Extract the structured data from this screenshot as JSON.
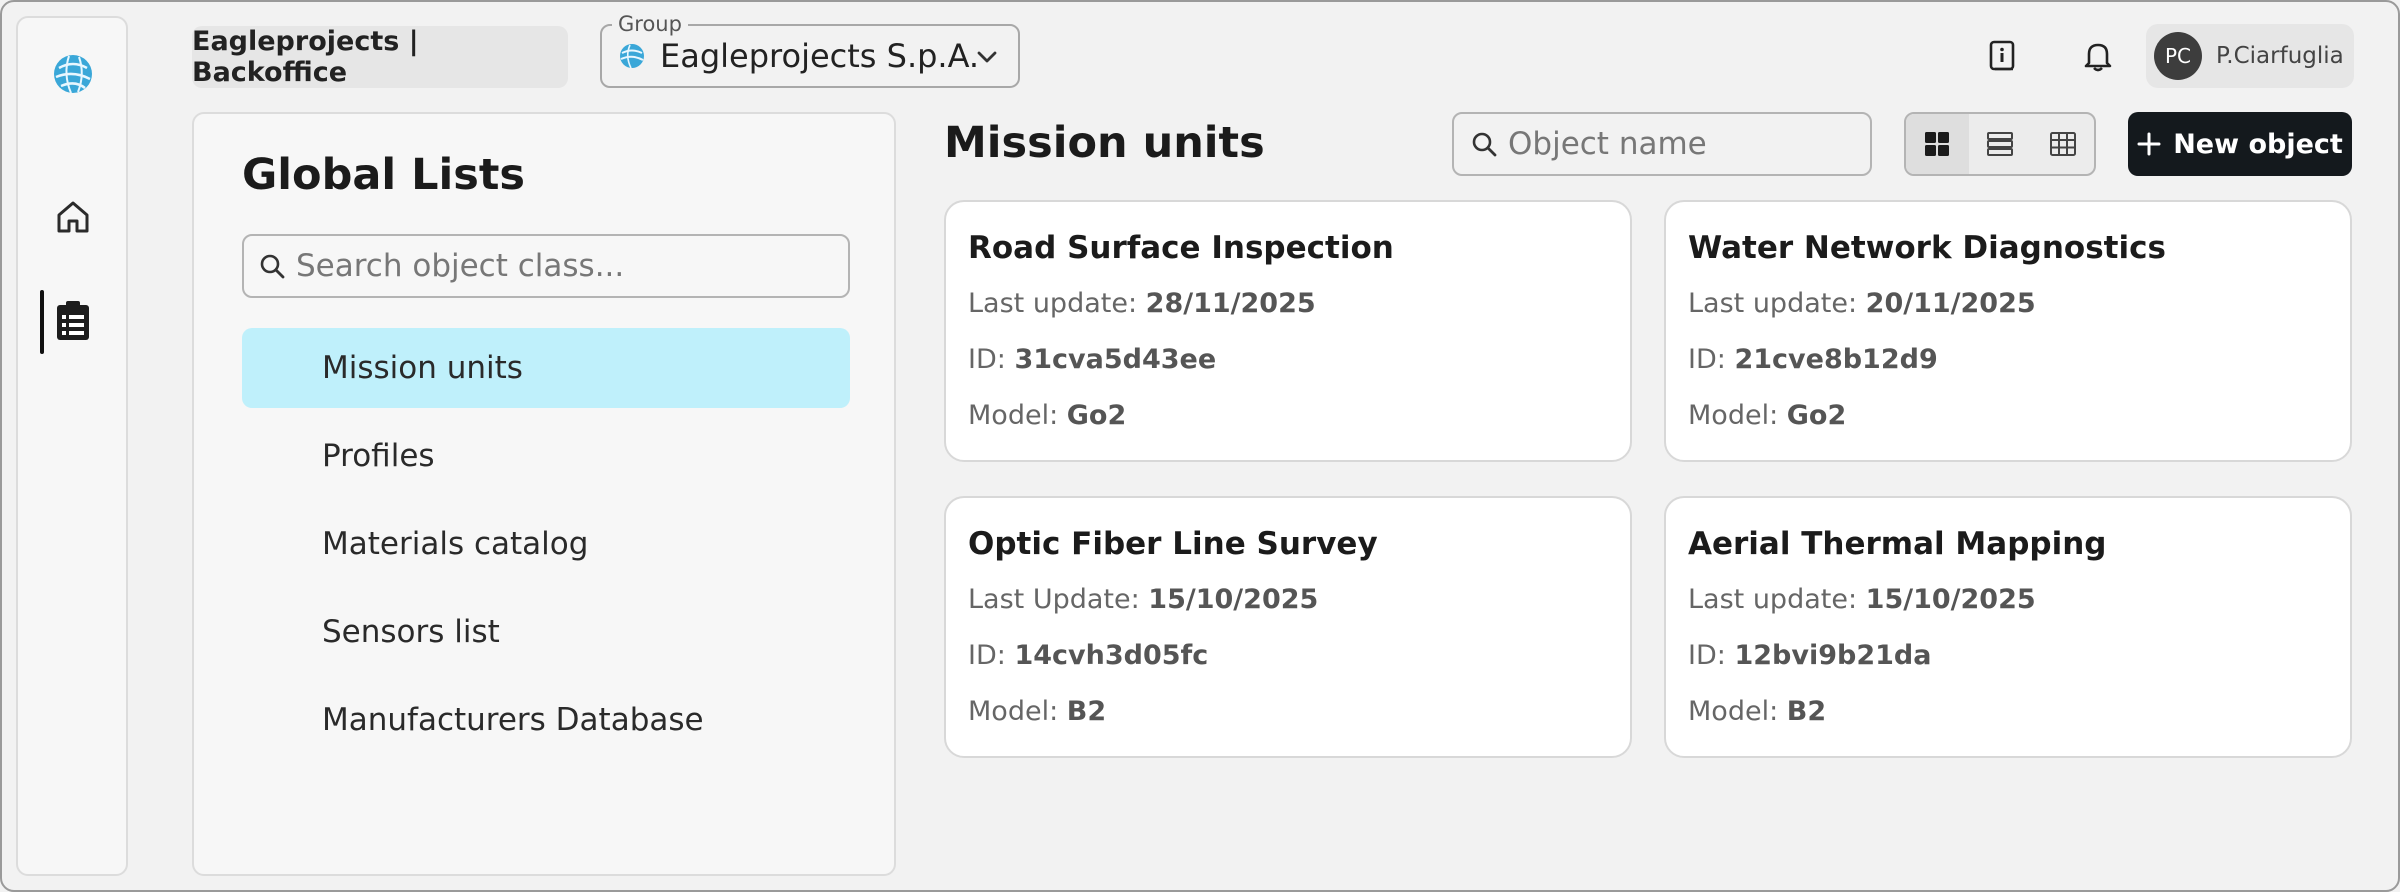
{
  "header": {
    "breadcrumb": "Eagleprojects | Backoffice",
    "group_legend": "Group",
    "group_value": "Eagleprojects S.p.A.",
    "user_initials": "PC",
    "user_name": "P.Ciarfuglia"
  },
  "sidebar": {
    "items": [
      {
        "icon": "home-icon"
      },
      {
        "icon": "clipboard-list-icon",
        "active": true
      }
    ]
  },
  "lists_panel": {
    "title": "Global Lists",
    "search_placeholder": "Search object class...",
    "items": [
      {
        "label": "Mission units",
        "active": true
      },
      {
        "label": "Profiles"
      },
      {
        "label": "Materials catalog"
      },
      {
        "label": "Sensors list"
      },
      {
        "label": "Manufacturers Database"
      }
    ]
  },
  "main": {
    "title": "Mission units",
    "search_placeholder": "Object name",
    "view_modes": [
      "grid",
      "list",
      "table"
    ],
    "active_view": "grid",
    "new_button": "New object",
    "cards": [
      {
        "title": "Road Surface Inspection",
        "update_label": "Last update:",
        "update": "28/11/2025",
        "id_label": "ID:",
        "id": "31cva5d43ee",
        "model_label": "Model:",
        "model": "Go2"
      },
      {
        "title": "Water Network Diagnostics",
        "update_label": "Last update:",
        "update": "20/11/2025",
        "id_label": "ID:",
        "id": "21cve8b12d9",
        "model_label": "Model:",
        "model": "Go2"
      },
      {
        "title": "Optic Fiber Line Survey",
        "update_label": "Last Update:",
        "update": "15/10/2025",
        "id_label": "ID:",
        "id": "14cvh3d05fc",
        "model_label": "Model:",
        "model": "B2"
      },
      {
        "title": "Aerial Thermal Mapping",
        "update_label": "Last update:",
        "update": "15/10/2025",
        "id_label": "ID:",
        "id": "12bvi9b21da",
        "model_label": "Model:",
        "model": "B2"
      }
    ]
  },
  "colors": {
    "accent_active": "#bff0fb",
    "primary_button": "#14191d",
    "logo_blue": "#3aa7d8"
  }
}
